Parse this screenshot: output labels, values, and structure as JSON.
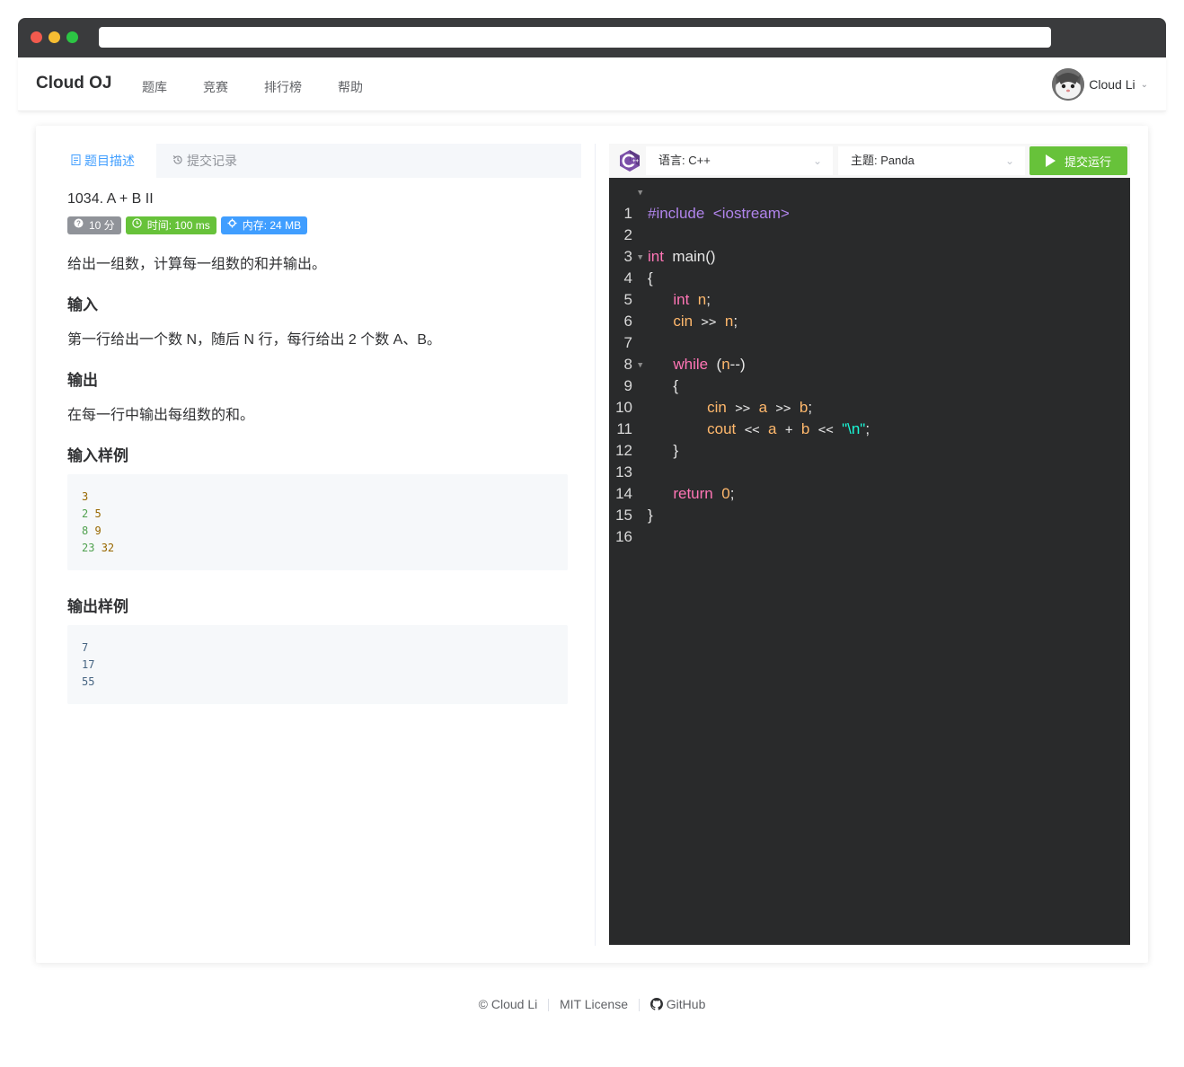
{
  "header": {
    "brand": "Cloud OJ",
    "nav": [
      "题库",
      "竞赛",
      "排行榜",
      "帮助"
    ],
    "user_name": "Cloud Li"
  },
  "tabs": {
    "description": "题目描述",
    "submissions": "提交记录"
  },
  "problem": {
    "title": "1034. A + B II",
    "tags": {
      "score": "10 分",
      "time": "时间: 100 ms",
      "memory": "内存: 24 MB"
    },
    "description": "给出一组数，计算每一组数的和并输出。",
    "input_heading": "输入",
    "input_text": "第一行给出一个数 N，随后 N 行，每行给出 2 个数 A、B。",
    "output_heading": "输出",
    "output_text": "在每一行中输出每组数的和。",
    "sample_input_heading": "输入样例",
    "sample_input": [
      [
        "3"
      ],
      [
        "2",
        "5"
      ],
      [
        "8",
        "9"
      ],
      [
        "23",
        "32"
      ]
    ],
    "sample_output_heading": "输出样例",
    "sample_output": [
      "7",
      "17",
      "55"
    ]
  },
  "editor": {
    "language_label": "语言: C++",
    "theme_label": "主题: Panda",
    "run_label": "提交运行",
    "line_numbers": [
      "1",
      "2",
      "3",
      "4",
      "5",
      "6",
      "7",
      "8",
      "9",
      "10",
      "11",
      "12",
      "13",
      "14",
      "15",
      "16"
    ]
  },
  "footer": {
    "copyright": "© Cloud Li",
    "license": "MIT License",
    "github": "GitHub"
  },
  "colors": {
    "accent": "#409eff",
    "success": "#67c23a",
    "editor_bg": "#292a2b"
  }
}
